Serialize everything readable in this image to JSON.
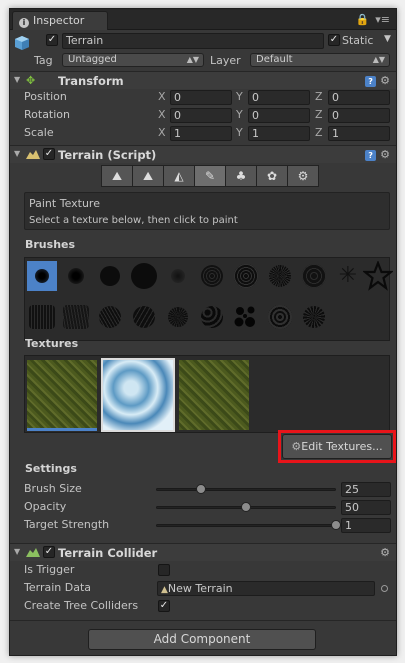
{
  "tab": {
    "title": "Inspector",
    "icons": [
      "lock-icon",
      "menu-icon"
    ]
  },
  "object": {
    "name": "Terrain",
    "enabled": true,
    "static_label": "Static",
    "static_checked": true,
    "tag_label": "Tag",
    "tag_value": "Untagged",
    "layer_label": "Layer",
    "layer_value": "Default"
  },
  "transform": {
    "title": "Transform",
    "rows": [
      {
        "label": "Position",
        "x": "0",
        "y": "0",
        "z": "0"
      },
      {
        "label": "Rotation",
        "x": "0",
        "y": "0",
        "z": "0"
      },
      {
        "label": "Scale",
        "x": "1",
        "y": "1",
        "z": "1"
      }
    ],
    "axes": [
      "X",
      "Y",
      "Z"
    ]
  },
  "terrain_script": {
    "title": "Terrain (Script)",
    "enabled": true,
    "tools": [
      "raise-lower-icon",
      "paint-height-icon",
      "smooth-height-icon",
      "paint-texture-icon",
      "place-trees-icon",
      "paint-details-icon",
      "settings-icon"
    ],
    "active_tool_index": 3,
    "help_title": "Paint Texture",
    "help_text": "Select a texture below, then click to paint",
    "brushes_label": "Brushes",
    "textures_label": "Textures",
    "edit_textures_label": "Edit Textures...",
    "settings_label": "Settings",
    "settings": [
      {
        "label": "Brush Size",
        "value": "25",
        "fraction": 0.25
      },
      {
        "label": "Opacity",
        "value": "50",
        "fraction": 0.5
      },
      {
        "label": "Target Strength",
        "value": "1",
        "fraction": 1.0
      }
    ]
  },
  "collider": {
    "title": "Terrain Collider",
    "enabled": true,
    "is_trigger_label": "Is Trigger",
    "is_trigger": false,
    "terrain_data_label": "Terrain Data",
    "terrain_data_value": "New Terrain",
    "tree_colliders_label": "Create Tree Colliders",
    "tree_colliders": true
  },
  "add_component_label": "Add Component",
  "colors": {
    "panel": "#383838",
    "highlight": "#e8141a",
    "selected": "#4c82c8"
  }
}
